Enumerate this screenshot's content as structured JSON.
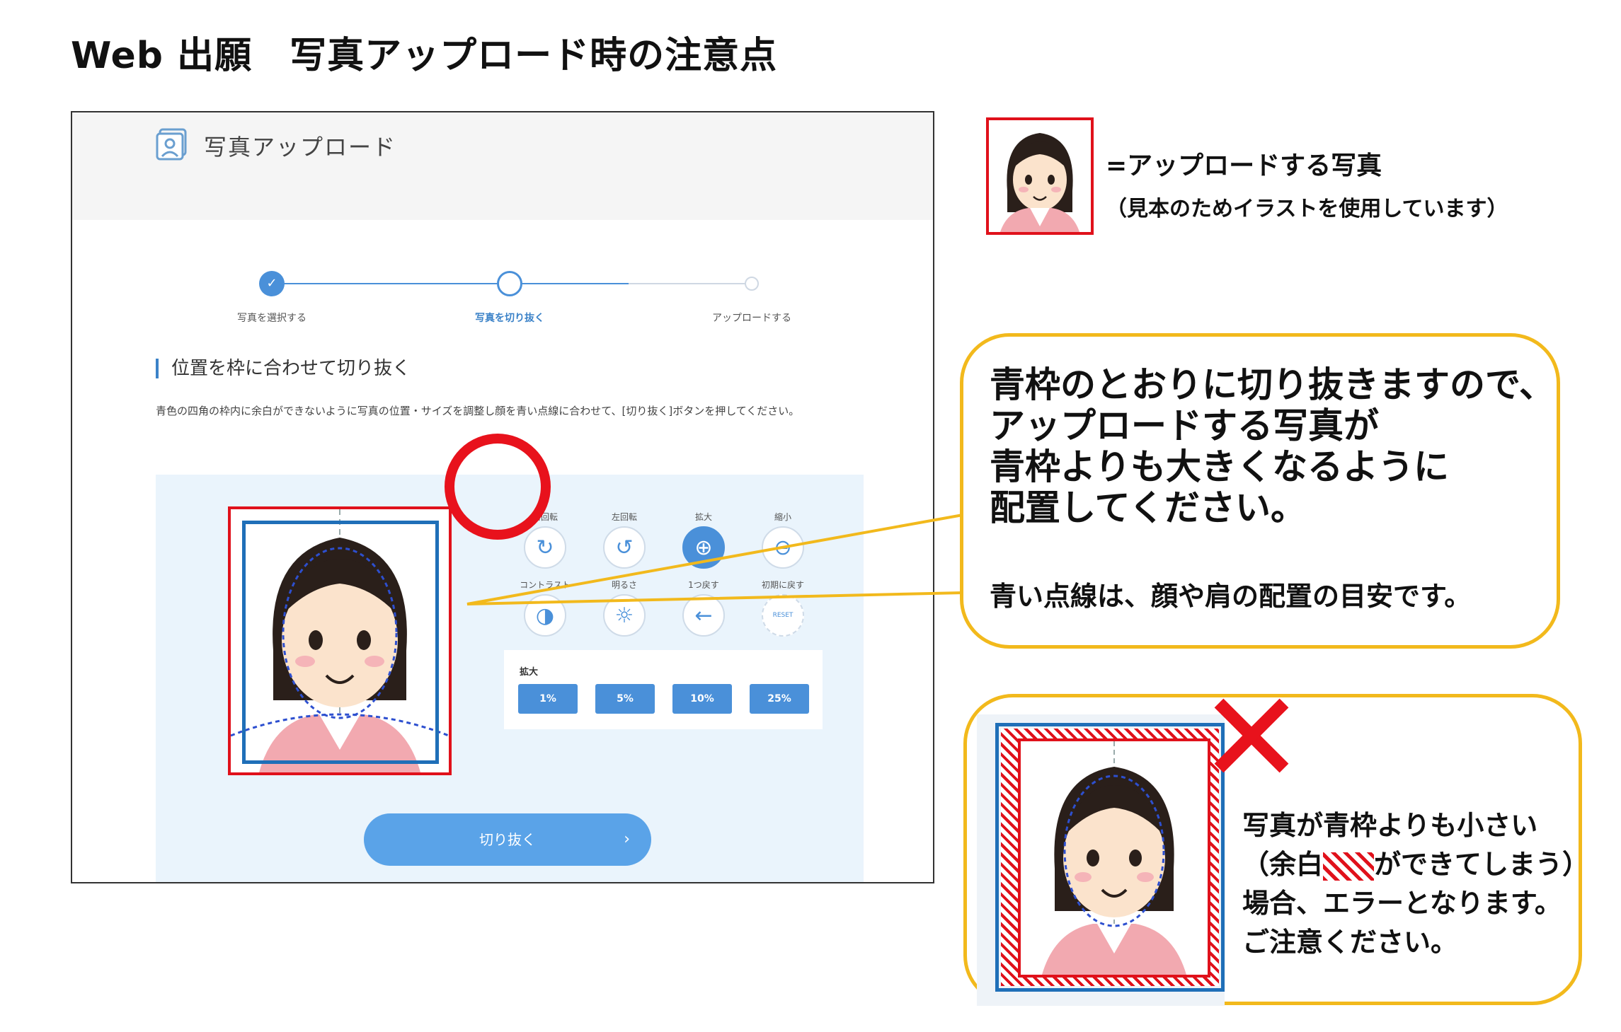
{
  "doc_title": "Web 出願　写真アップロード時の注意点",
  "upload_screen": {
    "header_title": "写真アップロード",
    "steps": [
      {
        "label": "写真を選択する",
        "state": "done"
      },
      {
        "label": "写真を切り抜く",
        "state": "current"
      },
      {
        "label": "アップロードする",
        "state": "todo"
      }
    ],
    "section_title": "位置を枠に合わせて切り抜く",
    "description": "青色の四角の枠内に余白ができないように写真の位置・サイズを調整し顔を青い点線に合わせて、[切り抜く]ボタンを押してください。",
    "tools": [
      {
        "label": "右回転",
        "icon": "rotate-right-icon",
        "glyph": "↻"
      },
      {
        "label": "左回転",
        "icon": "rotate-left-icon",
        "glyph": "↺"
      },
      {
        "label": "拡大",
        "icon": "zoom-in-icon",
        "glyph": "⊕"
      },
      {
        "label": "縮小",
        "icon": "zoom-out-icon",
        "glyph": "⊖"
      },
      {
        "label": "コントラスト",
        "icon": "contrast-icon",
        "glyph": "◑"
      },
      {
        "label": "明るさ",
        "icon": "brightness-icon",
        "glyph": "☼"
      },
      {
        "label": "1つ戻す",
        "icon": "undo-icon",
        "glyph": "←"
      },
      {
        "label": "初期に戻す",
        "icon": "reset-icon",
        "glyph": "RESET"
      }
    ],
    "zoom_label": "拡大",
    "zoom_steps": [
      "1%",
      "5%",
      "10%",
      "25%"
    ],
    "crop_button": "切り抜く",
    "crop_chevron": "›"
  },
  "legend": {
    "line1": "=アップロードする写真",
    "line2": "（見本のためイラストを使用しています）"
  },
  "callout_good": {
    "lines": [
      "青枠のとおりに切り抜きますので、",
      "アップロードする写真が",
      "青枠よりも大きくなるように",
      "配置してください。"
    ],
    "note": "青い点線は、顔や肩の配置の目安です。"
  },
  "callout_bad": {
    "line1": "写真が青枠よりも小さい",
    "line2_pre": "（余白",
    "line2_post": "ができてしまう）",
    "line3": "場合、エラーとなります。",
    "line4": "ご注意ください。"
  },
  "colors": {
    "accent_blue": "#4a90d9",
    "frame_blue": "#1f6fb8",
    "frame_red": "#e0111b",
    "bubble_border": "#f2b91c"
  }
}
